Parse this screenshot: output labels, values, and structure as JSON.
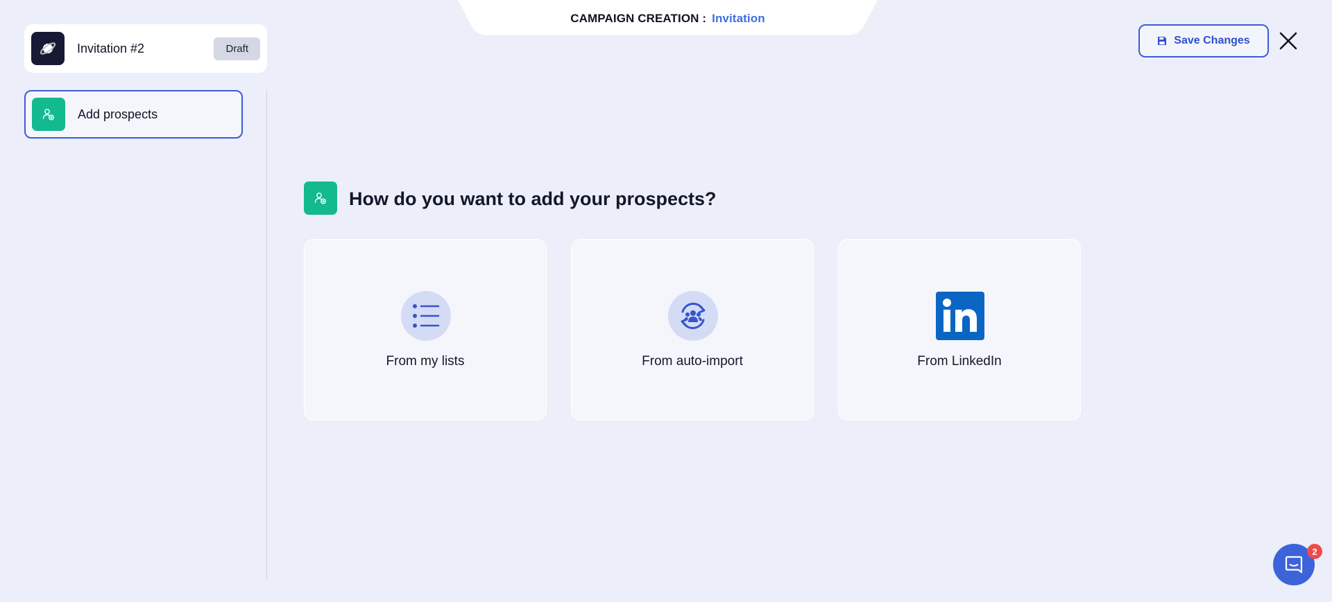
{
  "header": {
    "title_prefix": "CAMPAIGN CREATION :",
    "title_accent": "Invitation"
  },
  "campaign": {
    "name": "Invitation #2",
    "status": "Draft",
    "icon": "planet-icon"
  },
  "sidebar": {
    "steps": [
      {
        "label": "Add prospects",
        "icon": "user-add-icon",
        "active": true
      }
    ]
  },
  "toolbar": {
    "save_label": "Save Changes",
    "save_icon": "floppy-disk-icon",
    "close_icon": "close-icon"
  },
  "main": {
    "question": "How do you want to add your prospects?",
    "options": [
      {
        "label": "From my lists",
        "icon": "list-icon"
      },
      {
        "label": "From auto-import",
        "icon": "sync-users-icon"
      },
      {
        "label": "From LinkedIn",
        "icon": "linkedin-icon"
      }
    ]
  },
  "chat": {
    "badge_count": "2",
    "icon": "chat-icon"
  },
  "colors": {
    "background": "#eceff9",
    "accent": "#3e6ee0",
    "green": "#13b98f",
    "linkedin": "#0a66c2",
    "badge": "#f04a4a"
  }
}
